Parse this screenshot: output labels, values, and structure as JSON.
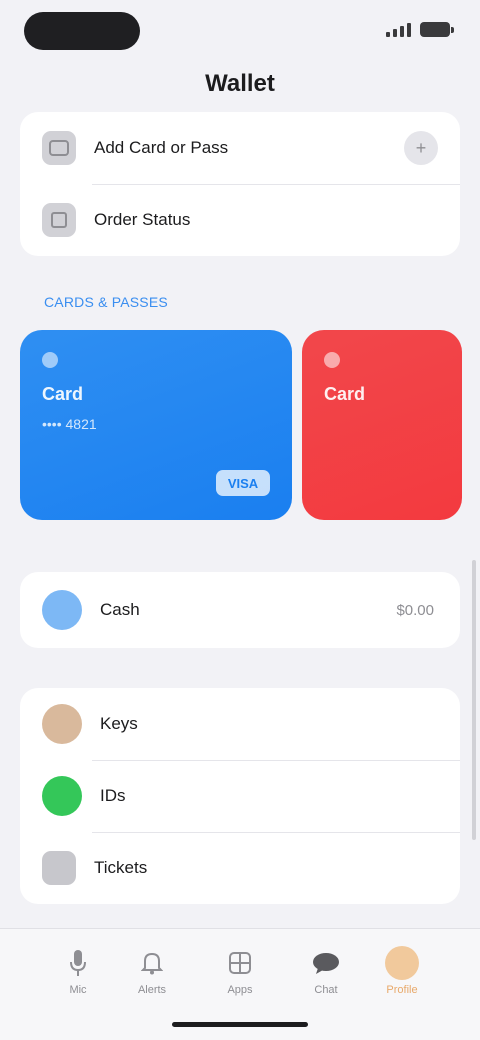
{
  "status_bar": {
    "signal_icon": "signal-icon",
    "battery_icon": "battery-icon"
  },
  "header": {
    "title": "Wallet"
  },
  "top_group": {
    "items": [
      {
        "label": "Add Card or Pass",
        "icon": "plus-card-icon",
        "trailing": "+"
      },
      {
        "label": "Order Status",
        "icon": "order-box-icon"
      }
    ]
  },
  "passes_section": {
    "header": "CARDS & PASSES",
    "cards": [
      {
        "name": "Card",
        "subtitle": "•••• 4821",
        "badge": "VISA",
        "color": "#1a7ff0"
      },
      {
        "name": "Card",
        "color": "#f33a3f"
      }
    ]
  },
  "balance_group": {
    "items": [
      {
        "label": "Cash",
        "value": "$0.00",
        "icon": "cash-icon",
        "color": "#7db8f5"
      }
    ]
  },
  "bottom_group": {
    "items": [
      {
        "label": "Keys",
        "icon": "key-icon",
        "color": "#d9b99c"
      },
      {
        "label": "IDs",
        "icon": "id-icon",
        "color": "#34c759"
      },
      {
        "label": "Tickets",
        "icon": "ticket-icon",
        "color": "#c7c7cc"
      }
    ]
  },
  "tab_bar": {
    "tabs": [
      {
        "label": "Mic",
        "icon": "mic-icon"
      },
      {
        "label": "Alerts",
        "icon": "bell-icon"
      },
      {
        "label": "Apps",
        "icon": "grid-icon"
      },
      {
        "label": "Chat",
        "icon": "chat-icon"
      },
      {
        "label": "Profile",
        "icon": "avatar",
        "active": true
      }
    ]
  },
  "colors": {
    "background": "#f2f2f6",
    "accent_blue": "#1a7ff0",
    "accent_red": "#f33a3f",
    "accent_green": "#34c759"
  }
}
